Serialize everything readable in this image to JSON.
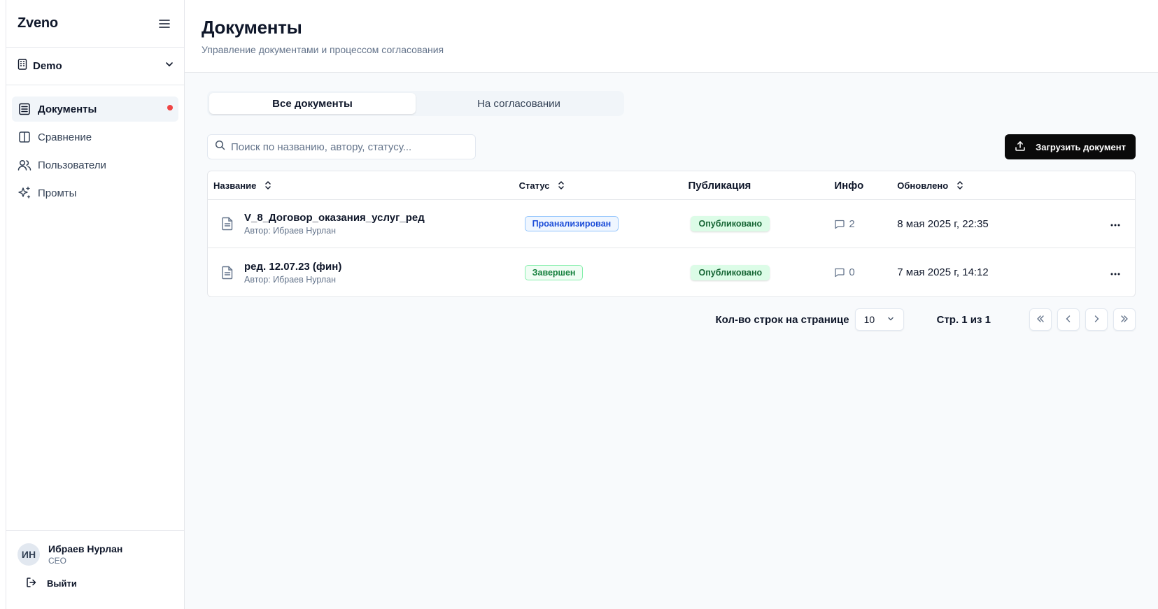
{
  "app": {
    "brand": "Zveno"
  },
  "sidebar": {
    "org": "Demo",
    "items": [
      {
        "label": "Документы",
        "icon": "documents-icon",
        "active": true
      },
      {
        "label": "Сравнение",
        "icon": "columns-icon"
      },
      {
        "label": "Пользователи",
        "icon": "users-icon"
      },
      {
        "label": "Промты",
        "icon": "sparkles-icon"
      }
    ],
    "user": {
      "initials": "ИН",
      "name": "Ибраев Нурлан",
      "role": "CEO"
    },
    "logout_label": "Выйти"
  },
  "header": {
    "title": "Документы",
    "subtitle": "Управление документами и процессом согласования"
  },
  "tabs": [
    "Все документы",
    "На согласовании"
  ],
  "search": {
    "placeholder": "Поиск по названию, автору, статусу..."
  },
  "upload_label": "Загрузить документ",
  "table": {
    "headers": {
      "name": "Название",
      "status": "Статус",
      "publication": "Публикация",
      "info": "Инфо",
      "updated": "Обновлено"
    },
    "rows": [
      {
        "title": "V_8_Договор_оказания_услуг_ред",
        "author": "Автор: Ибраев Нурлан",
        "status": "Проанализирован",
        "publication": "Опубликовано",
        "comments": "2",
        "updated": "8 мая 2025 г, 22:35"
      },
      {
        "title": "ред. 12.07.23 (фин)",
        "author": "Автор: Ибраев Нурлан",
        "status": "Завершен",
        "publication": "Опубликовано",
        "comments": "0",
        "updated": "7 мая 2025 г, 14:12"
      }
    ]
  },
  "pagination": {
    "rows_label": "Кол-во строк на странице",
    "rows_value": "10",
    "page_info": "Стр. 1 из 1"
  },
  "colors": {
    "accent": "#0a0a0a",
    "notify": "#ef4444",
    "status_blue": "#1d4ed8",
    "status_green": "#15803d"
  }
}
